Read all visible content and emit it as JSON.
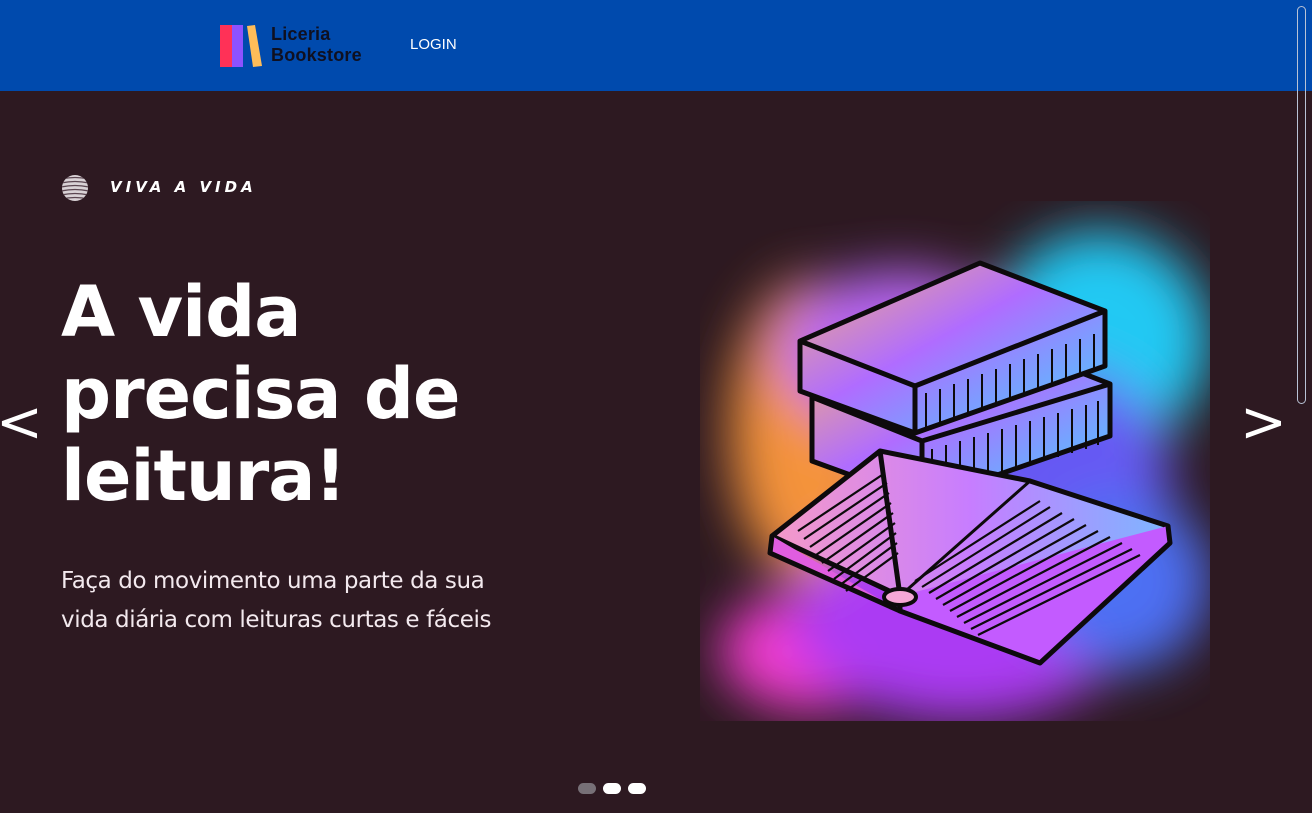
{
  "header": {
    "logo_line1": "Liceria",
    "logo_line2": "Bookstore",
    "login_label": "LOGIN"
  },
  "hero": {
    "tagline": "VIVA A VIDA",
    "headline_lines": [
      "A vida",
      "precisa de",
      "leitura!"
    ],
    "subtitle_lines": [
      "Faça do movimento uma parte da sua",
      "vida diária com leituras curtas e fáceis"
    ],
    "prev_label": "<",
    "next_label": ">",
    "illustration_icon": "books-illustration"
  },
  "carousel": {
    "slide_count": 3,
    "active_index": 0
  },
  "colors": {
    "header_bg": "#004aad",
    "hero_bg": "#2d1921",
    "text": "#ffffff",
    "logo_red": "#ff3157",
    "logo_purple": "#8c52ff",
    "logo_yellow": "#ffbd59"
  }
}
